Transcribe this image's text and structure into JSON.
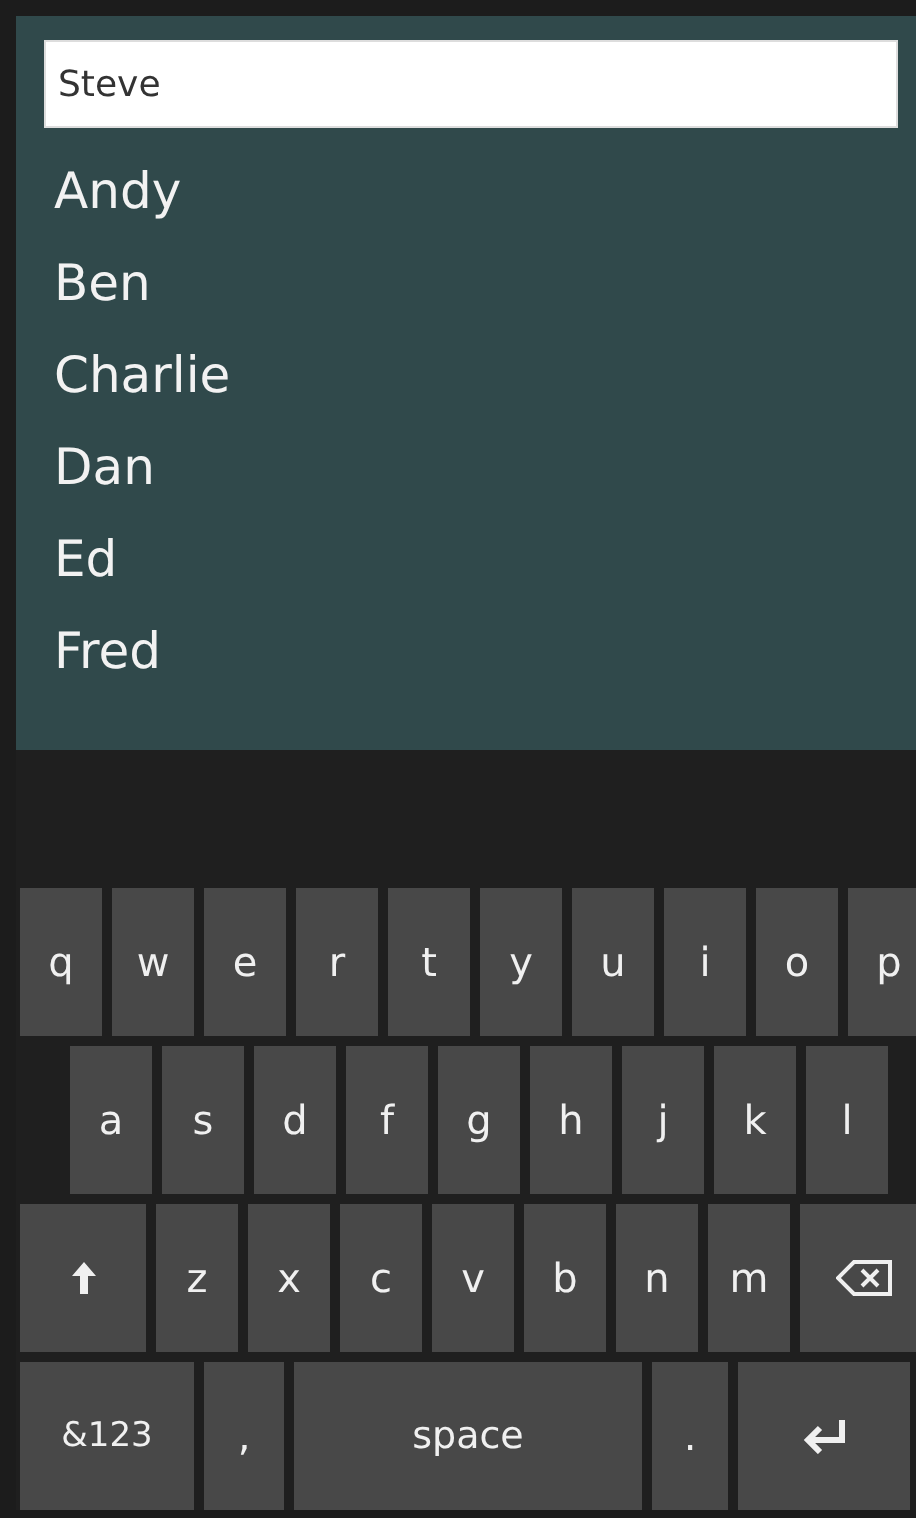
{
  "search": {
    "value": "Steve"
  },
  "names": [
    "Andy",
    "Ben",
    "Charlie",
    "Dan",
    "Ed",
    "Fred"
  ],
  "keyboard": {
    "rows": [
      [
        {
          "kind": "char",
          "label": "q"
        },
        {
          "kind": "char",
          "label": "w"
        },
        {
          "kind": "char",
          "label": "e"
        },
        {
          "kind": "char",
          "label": "r"
        },
        {
          "kind": "char",
          "label": "t"
        },
        {
          "kind": "char",
          "label": "y"
        },
        {
          "kind": "char",
          "label": "u"
        },
        {
          "kind": "char",
          "label": "i"
        },
        {
          "kind": "char",
          "label": "o"
        },
        {
          "kind": "char",
          "label": "p"
        }
      ],
      [
        {
          "kind": "char",
          "label": "a"
        },
        {
          "kind": "char",
          "label": "s"
        },
        {
          "kind": "char",
          "label": "d"
        },
        {
          "kind": "char",
          "label": "f"
        },
        {
          "kind": "char",
          "label": "g"
        },
        {
          "kind": "char",
          "label": "h"
        },
        {
          "kind": "char",
          "label": "j"
        },
        {
          "kind": "char",
          "label": "k"
        },
        {
          "kind": "char",
          "label": "l"
        }
      ],
      [
        {
          "kind": "shift"
        },
        {
          "kind": "char",
          "label": "z"
        },
        {
          "kind": "char",
          "label": "x"
        },
        {
          "kind": "char",
          "label": "c"
        },
        {
          "kind": "char",
          "label": "v"
        },
        {
          "kind": "char",
          "label": "b"
        },
        {
          "kind": "char",
          "label": "n"
        },
        {
          "kind": "char",
          "label": "m"
        },
        {
          "kind": "backspace"
        }
      ]
    ],
    "bottom_row": [
      {
        "kind": "wide",
        "label": "&123"
      },
      {
        "kind": "char",
        "label": ","
      },
      {
        "kind": "space",
        "label": "space"
      },
      {
        "kind": "char",
        "label": "."
      },
      {
        "kind": "enter"
      }
    ]
  }
}
